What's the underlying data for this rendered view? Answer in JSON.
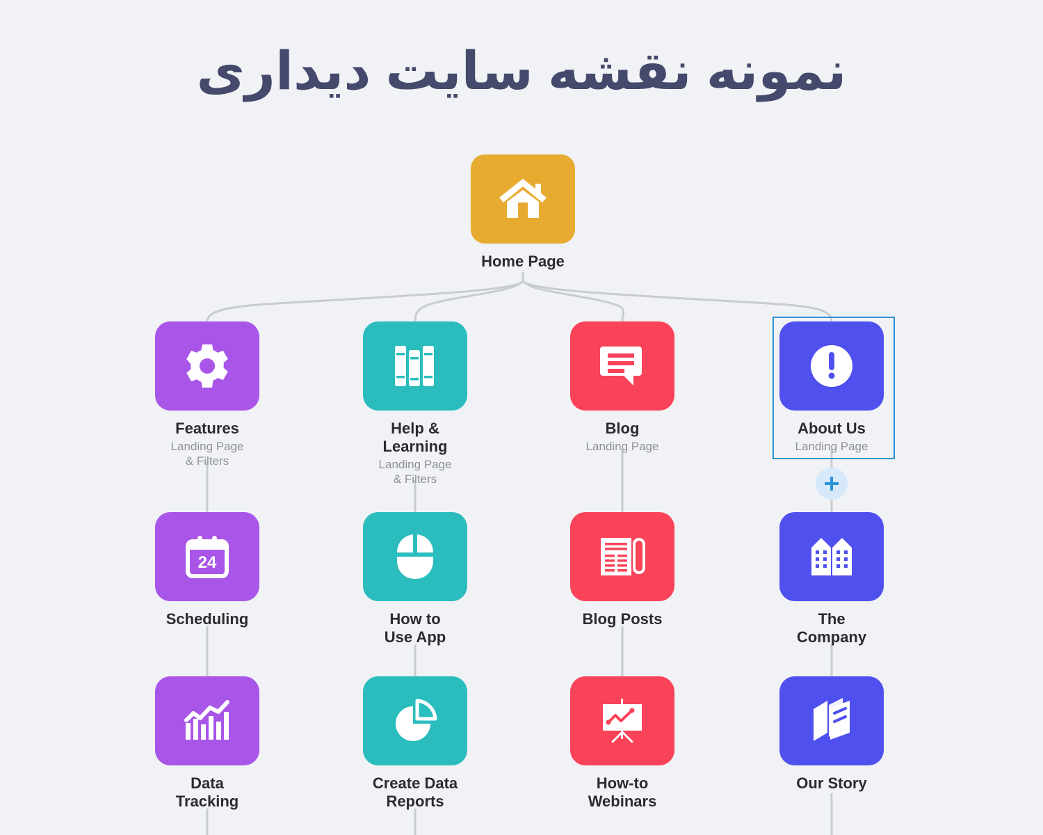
{
  "title": "نمونه نقشه سایت دیداری",
  "colors": {
    "background": "#f0f2f5",
    "title_text": "#45496b",
    "connector": "#c9cccf",
    "label_text": "#2b2b33",
    "sub_text": "#8e9196",
    "home_orange": "#e8ab32",
    "features_purple": "#a855e8",
    "help_teal": "#2bbdbd",
    "blog_red": "#fa4259",
    "about_indigo": "#4f50ed",
    "selection_border": "#2b92d4",
    "plus_circle": "#d5e9fb",
    "plus_glyph": "#2b92d4"
  },
  "root": {
    "label": "Home Page",
    "sub": "",
    "icon": "house-icon",
    "color": "#e8ab32"
  },
  "columns": [
    {
      "color": "#a855e8",
      "nodes": [
        {
          "label": "Features",
          "sub": "Landing Page\n& Filters",
          "icon": "gear-icon"
        },
        {
          "label": "Scheduling",
          "sub": "",
          "icon": "calendar-24-icon"
        },
        {
          "label": "Data\nTracking",
          "sub": "",
          "icon": "bar-chart-trend-icon"
        }
      ]
    },
    {
      "color": "#2bbdbd",
      "nodes": [
        {
          "label": "Help &\nLearning",
          "sub": "Landing Page\n& Filters",
          "icon": "books-icon"
        },
        {
          "label": "How to\nUse App",
          "sub": "",
          "icon": "mouse-icon"
        },
        {
          "label": "Create Data\nReports",
          "sub": "",
          "icon": "pie-chart-icon"
        }
      ]
    },
    {
      "color": "#fa4259",
      "nodes": [
        {
          "label": "Blog",
          "sub": "Landing Page",
          "icon": "chat-bubble-icon"
        },
        {
          "label": "Blog Posts",
          "sub": "",
          "icon": "newspaper-icon"
        },
        {
          "label": "How-to\nWebinars",
          "sub": "",
          "icon": "presentation-chart-icon"
        }
      ]
    },
    {
      "color": "#4f50ed",
      "selected": true,
      "nodes": [
        {
          "label": "About Us",
          "sub": "Landing Page",
          "icon": "exclamation-circle-icon"
        },
        {
          "label": "The\nCompany",
          "sub": "",
          "icon": "office-building-icon"
        },
        {
          "label": "Our Story",
          "sub": "",
          "icon": "open-book-icon"
        }
      ]
    }
  ],
  "plus_button": {
    "label": "+",
    "icon": "plus-icon"
  }
}
